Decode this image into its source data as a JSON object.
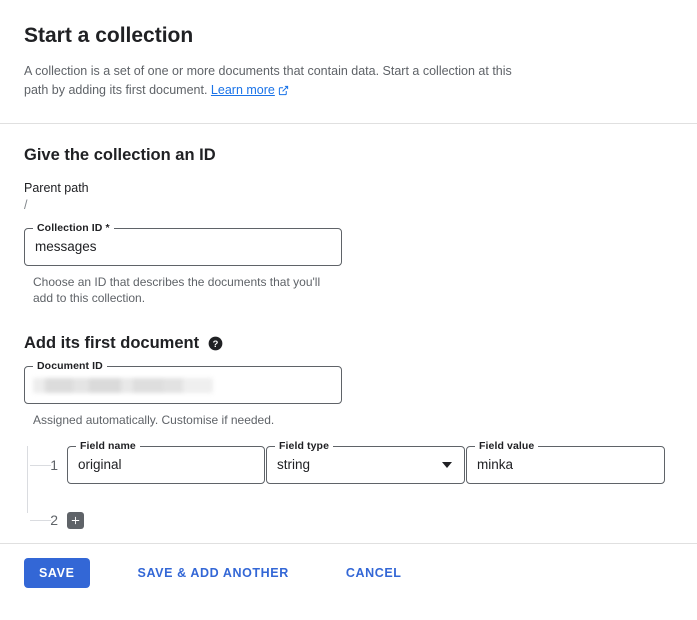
{
  "header": {
    "title": "Start a collection",
    "description_part1": "A collection is a set of one or more documents that contain data. Start a collection at this path by adding its first document.",
    "learn_more_label": "Learn more",
    "learn_more_icon": "external-link-icon"
  },
  "collection_section": {
    "title": "Give the collection an ID",
    "parent_path_label": "Parent path",
    "parent_path_value": "/",
    "collection_id_label": "Collection ID *",
    "collection_id_value": "messages",
    "helper_text": "Choose an ID that describes the documents that you'll add to this collection."
  },
  "document_section": {
    "title": "Add its first document",
    "help_icon": "help-icon",
    "document_id_label": "Document ID",
    "document_id_value": "",
    "helper_text": "Assigned automatically. Customise if needed."
  },
  "fields": {
    "name_label": "Field name",
    "type_label": "Field type",
    "value_label": "Field value",
    "rows": [
      {
        "index": "1",
        "name": "original",
        "type": "string",
        "value": "minka"
      },
      {
        "index": "2"
      }
    ],
    "add_row_icon": "plus-icon",
    "dropdown_icon": "chevron-down-icon"
  },
  "footer": {
    "save_label": "SAVE",
    "save_add_another_label": "SAVE & ADD ANOTHER",
    "cancel_label": "CANCEL"
  },
  "colors": {
    "accent_blue": "#3367d6",
    "link_blue": "#1a73e8",
    "text_primary": "#202124",
    "text_secondary": "#5f6368",
    "border": "#5f6368",
    "divider": "#e0e0e0"
  }
}
